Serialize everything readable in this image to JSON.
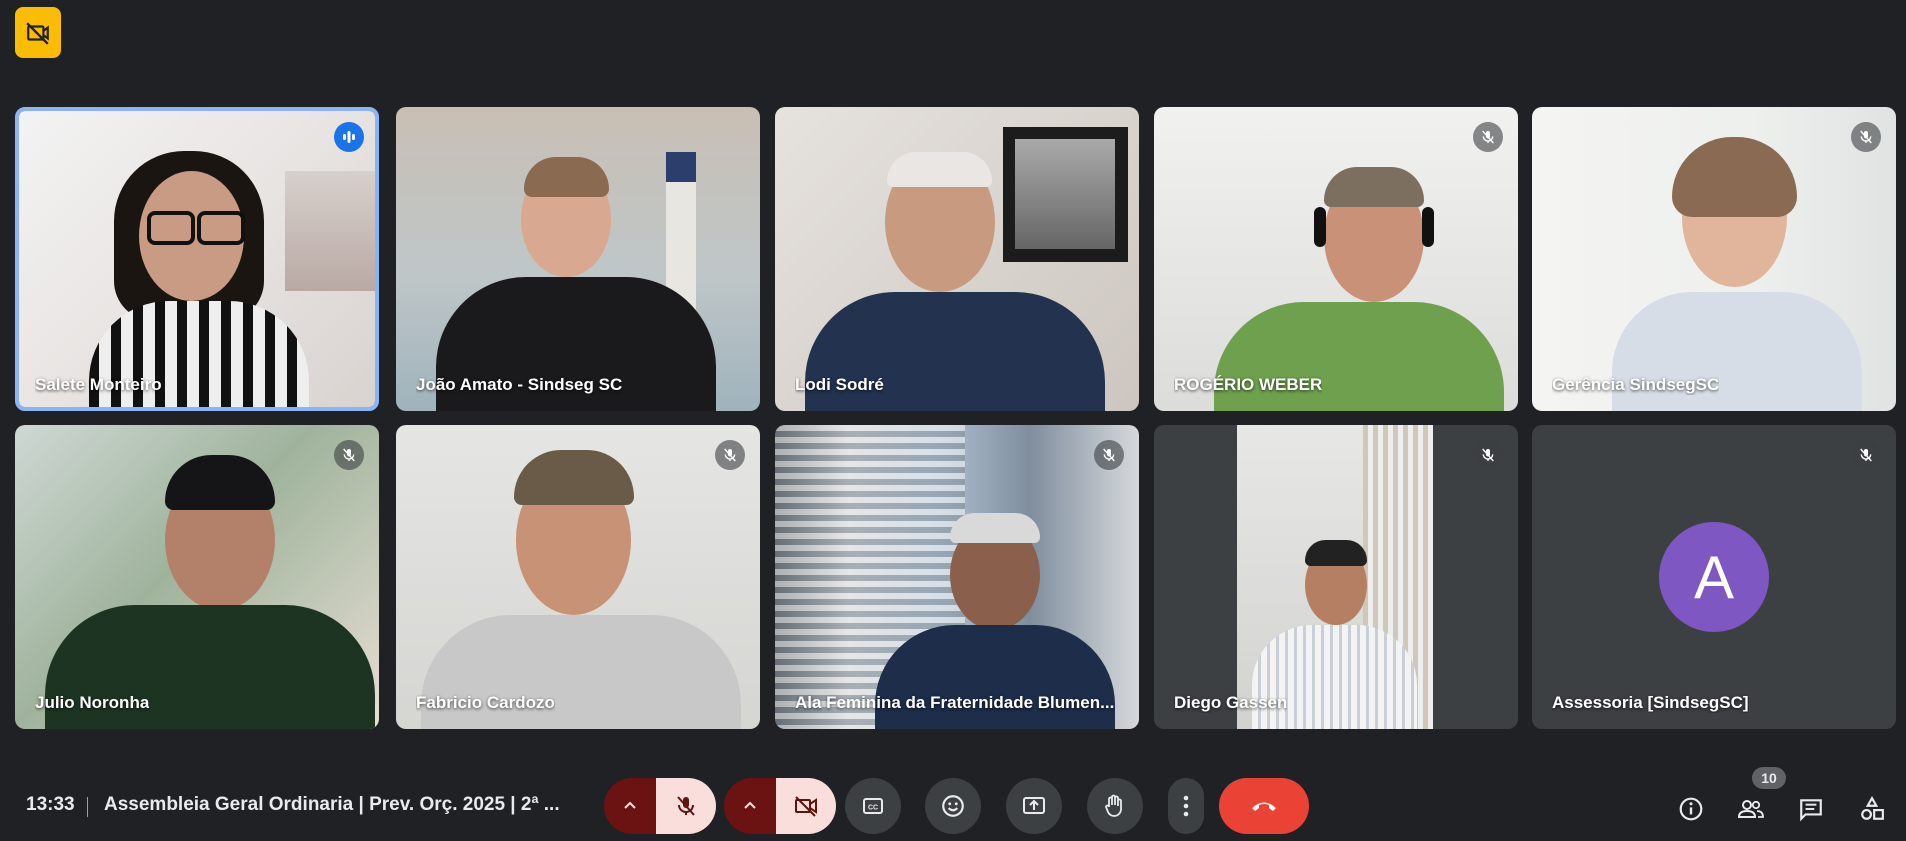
{
  "meeting": {
    "time": "13:33",
    "title": "Assembleia Geral Ordinaria | Prev. Orç. 2025 | 2ª ..."
  },
  "recording_badge_icon": "recording-off-icon",
  "participants": [
    {
      "name": "Salete Monteiro",
      "status": "speaking"
    },
    {
      "name": "João Amato - Sindseg SC",
      "status": "unmuted"
    },
    {
      "name": "Lodi Sodré",
      "status": "unmuted"
    },
    {
      "name": "ROGÉRIO WEBER",
      "status": "muted"
    },
    {
      "name": "Gerência SindsegSC",
      "status": "muted"
    },
    {
      "name": "Julio Noronha",
      "status": "muted"
    },
    {
      "name": "Fabricio Cardozo",
      "status": "muted"
    },
    {
      "name": "Ala Feminina da Fraternidade Blumen...",
      "status": "muted"
    },
    {
      "name": "Diego Gassen",
      "status": "muted"
    },
    {
      "name": "Assessoria [SindsegSC]",
      "status": "muted",
      "avatar_letter": "A",
      "avatar_color": "#7e57c2"
    }
  ],
  "controls": {
    "mic": "mic-off-icon",
    "camera": "camera-off-icon",
    "captions": "captions-icon",
    "reactions": "emoji-icon",
    "present": "present-screen-icon",
    "raise_hand": "raise-hand-icon",
    "more": "more-options-icon",
    "hangup": "hangup-icon"
  },
  "side_controls": {
    "info": "info-icon",
    "people": "people-icon",
    "people_count": "10",
    "chat": "chat-icon",
    "activities": "activities-icon"
  },
  "colors": {
    "background": "#202124",
    "active_speaker_border": "#8ab4f8",
    "hangup": "#ea4335",
    "mic_off_bg": "#f9dedc",
    "recording_badge": "#fbbc04"
  }
}
